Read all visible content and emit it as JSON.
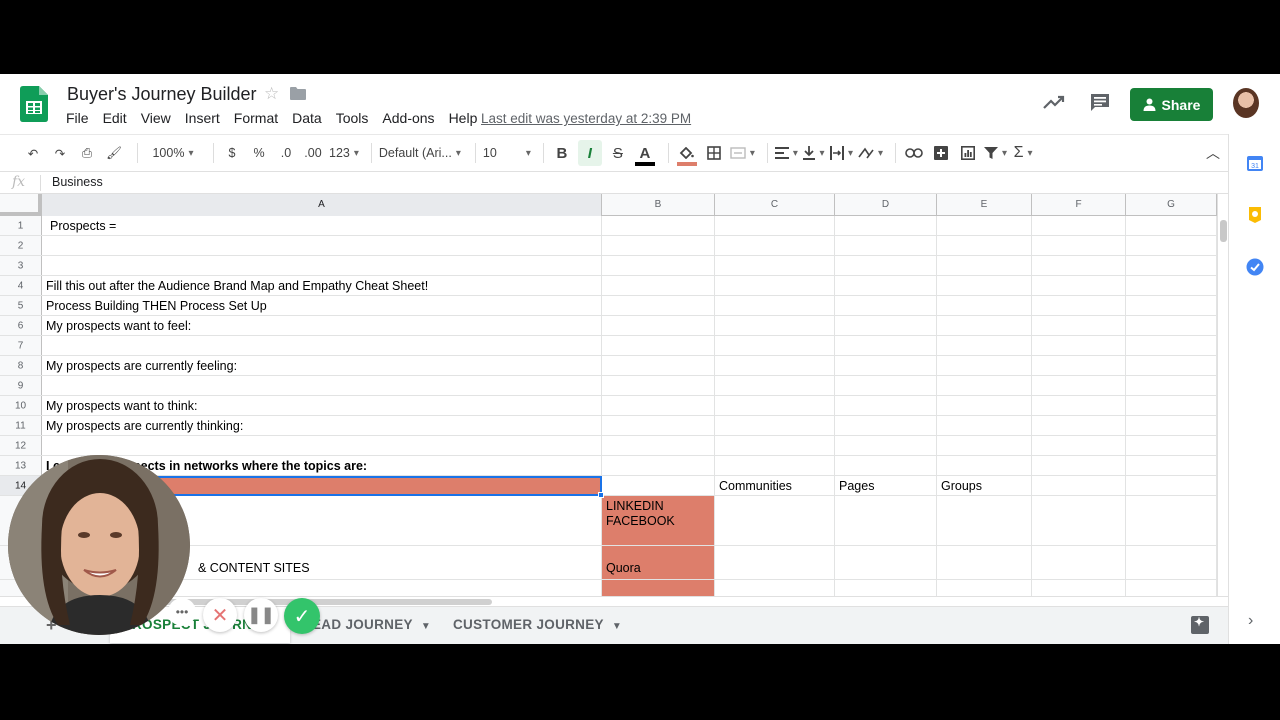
{
  "header": {
    "title": "Buyer's Journey Builder",
    "menu": [
      "File",
      "Edit",
      "View",
      "Insert",
      "Format",
      "Data",
      "Tools",
      "Add-ons",
      "Help"
    ],
    "last_edit": "Last edit was yesterday at 2:39 PM",
    "share_label": "Share"
  },
  "toolbar": {
    "zoom": "100%",
    "currency": "$",
    "percent": "%",
    "decimal_decrease": ".0",
    "decimal_increase": ".00",
    "number_format": "123",
    "font": "Default (Ari...",
    "font_size": "10",
    "bold": "B",
    "italic": "I",
    "strike": "S",
    "text_color": "A"
  },
  "formula_bar": {
    "fx": "fx",
    "value": "Business"
  },
  "columns": [
    "A",
    "B",
    "C",
    "D",
    "E",
    "F",
    "G"
  ],
  "rows": {
    "r1": {
      "num": "1",
      "A": "Prospects ="
    },
    "r2": {
      "num": "2"
    },
    "r3": {
      "num": "3"
    },
    "r4": {
      "num": "4",
      "A": "Fill this out after the Audience Brand Map and Empathy Cheat Sheet!"
    },
    "r5": {
      "num": "5",
      "A": "Process Building THEN Process Set Up"
    },
    "r6": {
      "num": "6",
      "A": "My prospects  want to feel:"
    },
    "r7": {
      "num": "7"
    },
    "r8": {
      "num": "8",
      "A": "My prospects are currently feeling:"
    },
    "r9": {
      "num": "9"
    },
    "r10": {
      "num": "10",
      "A": "My prospects want to think:"
    },
    "r11": {
      "num": "11",
      "A": "My prospects are currently thinking:"
    },
    "r12": {
      "num": "12"
    },
    "r13": {
      "num": "13",
      "A": "I c",
      "A_rest": "prospects in networks where the topics are:"
    },
    "r14": {
      "num": "14",
      "C": "Communities",
      "D": "Pages",
      "E": "Groups"
    },
    "r15": {
      "B": "LINKEDIN FACEBOOK"
    },
    "r16": {
      "A": "& CONTENT SITES",
      "B": "Quora"
    }
  },
  "sheet_tabs": [
    {
      "label": "PROSPECT J...",
      "visible": "ROSPECT JOURNEY"
    },
    {
      "label": "LEAD JOURNEY",
      "visible": "EAD JOURNEY"
    },
    {
      "label": "CUSTOMER JOURNEY"
    }
  ],
  "colors": {
    "accent_green": "#188038",
    "highlight_red": "#dd7e6b",
    "selection_blue": "#1a73e8"
  },
  "icons": [
    "sheets-logo-icon",
    "star-icon",
    "folder-icon",
    "trend-icon",
    "comment-icon",
    "person-icon",
    "calendar-icon",
    "keep-icon",
    "tasks-icon"
  ]
}
